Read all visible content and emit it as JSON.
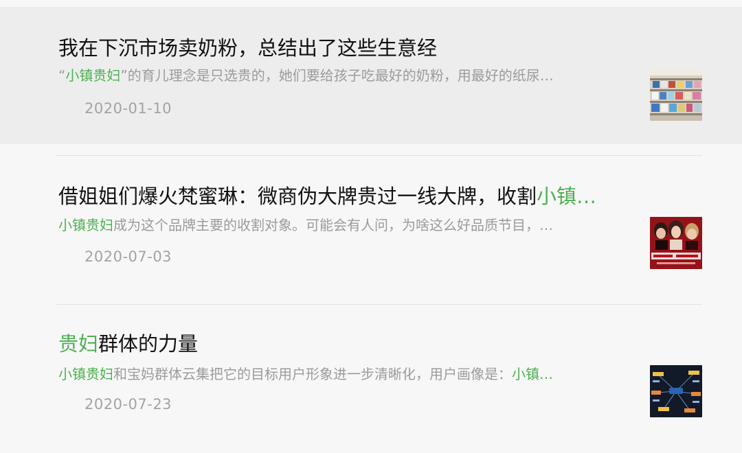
{
  "articles": [
    {
      "title_parts": [
        {
          "text": "我在下沉市场卖奶粉，总结出了这些生意经",
          "hl": false
        }
      ],
      "snippet_parts": [
        {
          "text": "“",
          "hl": false
        },
        {
          "text": "小镇贵妇",
          "hl": true
        },
        {
          "text": "”的育儿理念是只选贵的，她们要给孩子吃最好的奶粉，用最好的纸尿…",
          "hl": false
        }
      ],
      "date": "2020-01-10",
      "thumbnail": "store-shelves-photo"
    },
    {
      "title_parts": [
        {
          "text": "借姐姐们爆火梵蜜琳：微商伪大牌贵过一线大牌，收割",
          "hl": false
        },
        {
          "text": "小镇…",
          "hl": true
        }
      ],
      "snippet_parts": [
        {
          "text": "小镇贵妇",
          "hl": true
        },
        {
          "text": "成为这个品牌主要的收割对象。可能会有人问，为啥这么好品质节目，…",
          "hl": false
        }
      ],
      "date": "2020-07-03",
      "thumbnail": "tv-show-poster-photo"
    },
    {
      "title_parts": [
        {
          "text": "贵妇",
          "hl": true
        },
        {
          "text": "群体的力量",
          "hl": false
        }
      ],
      "snippet_parts": [
        {
          "text": "小镇贵妇",
          "hl": true
        },
        {
          "text": "和宝妈群体云集把它的目标用户形象进一步清晰化，用户画像是：",
          "hl": false
        },
        {
          "text": "小镇…",
          "hl": true
        }
      ],
      "date": "2020-07-23",
      "thumbnail": "mind-map-diagram-image"
    }
  ],
  "colors": {
    "highlight": "#4cb050",
    "title": "#111111",
    "snippet": "#9b9b9b",
    "date": "#a3a3a3"
  }
}
